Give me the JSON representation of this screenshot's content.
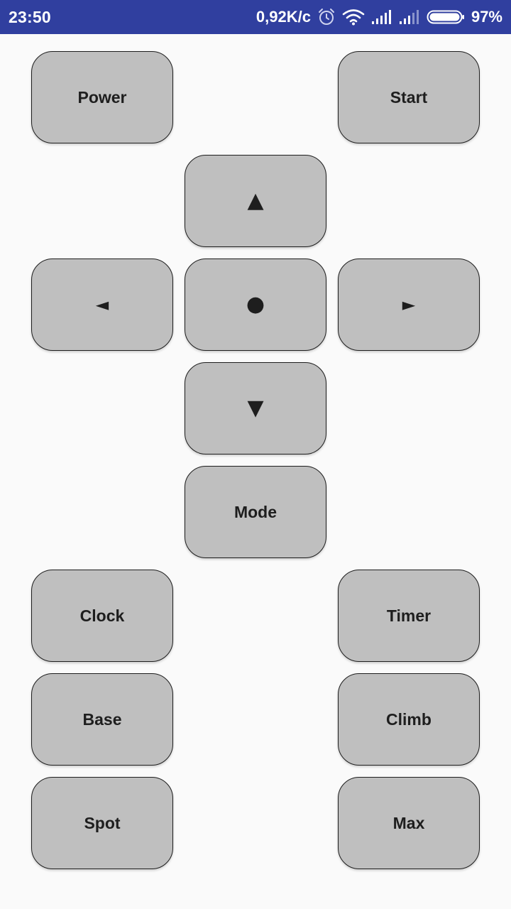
{
  "status_bar": {
    "time": "23:50",
    "network_speed": "0,92K/c",
    "battery_percent": "97%",
    "icons": [
      "alarm-icon",
      "wifi-icon",
      "signal-icon",
      "signal-icon",
      "battery-icon"
    ],
    "background_color": "#303f9f",
    "battery_level": 0.97
  },
  "remote": {
    "power": "Power",
    "start": "Start",
    "up": "▲",
    "left": "◄",
    "ok": "●",
    "right": "►",
    "down": "▼",
    "mode": "Mode",
    "clock": "Clock",
    "timer": "Timer",
    "base": "Base",
    "climb": "Climb",
    "spot": "Spot",
    "max": "Max",
    "button_color": "#bfbfbf",
    "background_color": "#fafafa"
  }
}
